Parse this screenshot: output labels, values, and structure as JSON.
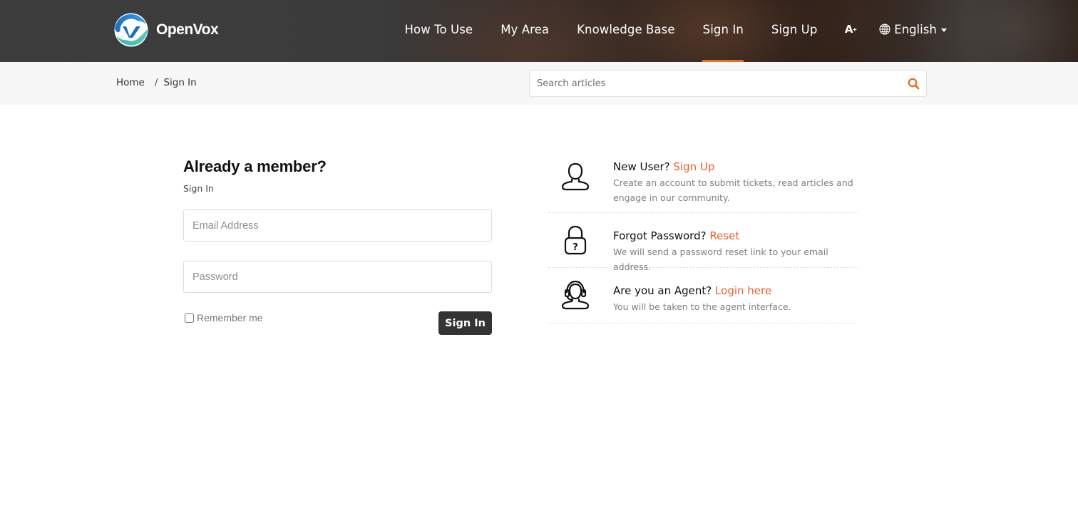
{
  "brand": {
    "name": "OpenVox",
    "accent_color": "#e8702a",
    "link_color": "#e8622a"
  },
  "nav": {
    "items": [
      {
        "label": "How To Use",
        "active": false
      },
      {
        "label": "My Area",
        "active": false
      },
      {
        "label": "Knowledge Base",
        "active": false
      },
      {
        "label": "Sign In",
        "active": true
      },
      {
        "label": "Sign Up",
        "active": false
      }
    ],
    "font_size_toggle": {
      "label": "A",
      "sup": "+",
      "icon": "font-size-increase-icon"
    },
    "language": {
      "label": "English",
      "icon": "globe-icon"
    }
  },
  "breadcrumb": {
    "items": [
      "Home",
      "Sign In"
    ],
    "separator": "/"
  },
  "search": {
    "placeholder": "Search articles",
    "value": "",
    "icon": "search-icon"
  },
  "signin": {
    "title": "Already a member?",
    "subtitle": "Sign In",
    "email_placeholder": "Email Address",
    "email_value": "",
    "password_placeholder": "Password",
    "password_value": "",
    "remember_label": "Remember me",
    "remember_checked": false,
    "submit_label": "Sign In"
  },
  "info": [
    {
      "icon": "user-icon",
      "heading": "New User?",
      "link": "Sign Up",
      "description": "Create an account to submit tickets, read articles and engage in our community."
    },
    {
      "icon": "lock-question-icon",
      "heading": "Forgot Password?",
      "link": "Reset",
      "description": "We will send a password reset link to your email address."
    },
    {
      "icon": "agent-headset-icon",
      "heading": "Are you an Agent?",
      "link": "Login here",
      "description": "You will be taken to the agent interface."
    }
  ]
}
